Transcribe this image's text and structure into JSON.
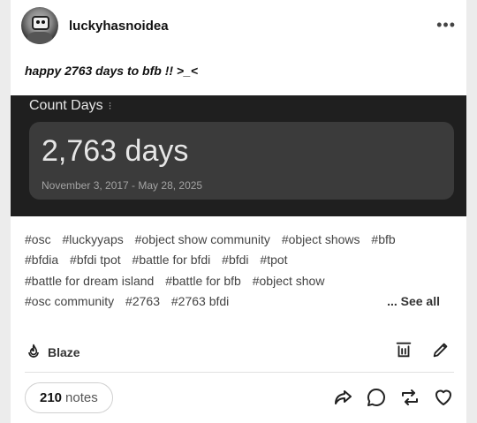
{
  "post": {
    "username": "luckyhasnoidea",
    "more_label": "•••",
    "caption": "happy 2763 days to bfb !! >_<",
    "widget": {
      "title": "Count Days",
      "title_menu": "⁝",
      "count": "2,763 days",
      "range": "November 3, 2017 - May 28, 2025"
    },
    "tags": [
      "#osc",
      "#luckyyaps",
      "#object show community",
      "#object shows",
      "#bfb",
      "#bfdia",
      "#bfdi tpot",
      "#battle for bfdi",
      "#bfdi",
      "#tpot",
      "#battle for dream island",
      "#battle for bfb",
      "#object show",
      "#osc community",
      "#2763",
      "#2763 bfdi"
    ],
    "see_all": "... See all",
    "blaze_label": "Blaze",
    "notes": {
      "count": "210",
      "word": "notes"
    }
  }
}
